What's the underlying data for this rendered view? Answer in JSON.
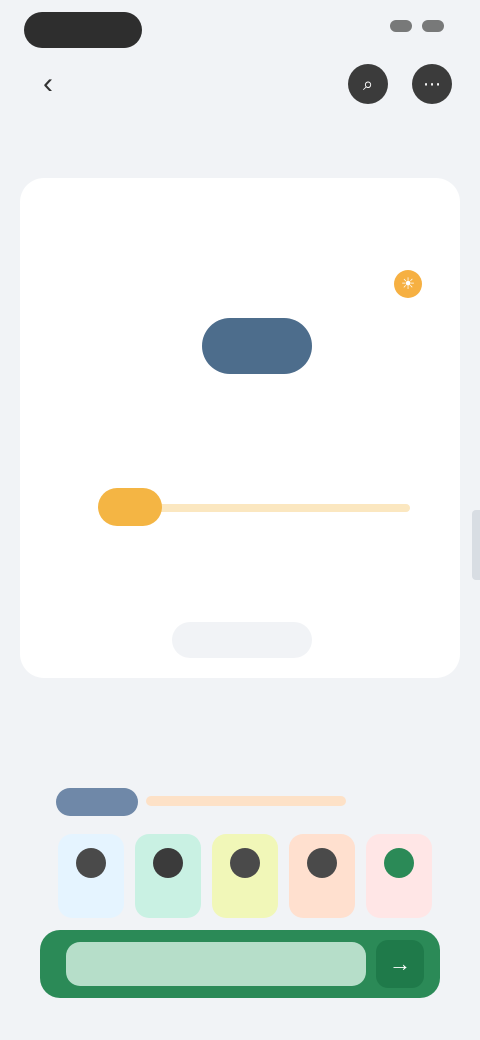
{
  "top": {
    "pill_text": "",
    "round_btn_1_icon": "search-icon",
    "round_btn_2_icon": "more-icon"
  },
  "header": {
    "title": "",
    "right_text": ""
  },
  "card": {
    "tabs": [
      "",
      "",
      ""
    ],
    "active_tab_index": 0,
    "left_label": "",
    "sun_icon": "sun-icon",
    "axis_labels": [
      "",
      "",
      "",
      "",
      "",
      ""
    ],
    "blue_badge": "",
    "orange_badge": "",
    "caption": "",
    "mini_button": ""
  },
  "section2": {
    "title": "",
    "right_text": "",
    "week_label": "",
    "days": [
      {
        "label": "",
        "color": "#e5f4ff"
      },
      {
        "label": "",
        "color": "#c9f1e3"
      },
      {
        "label": "",
        "color": "#f1f7b8"
      },
      {
        "label": "",
        "color": "#ffe0cf"
      },
      {
        "label": "",
        "color": "#ffe6e6"
      }
    ]
  },
  "cta": {
    "left_text": "",
    "mid_text": "",
    "arrow_icon": "arrow-right-icon"
  },
  "colors": {
    "primary_green": "#2b8a57",
    "blue_badge": "#4d6d8c",
    "orange_badge": "#f4b544",
    "title_blue": "#3d6aa8"
  }
}
